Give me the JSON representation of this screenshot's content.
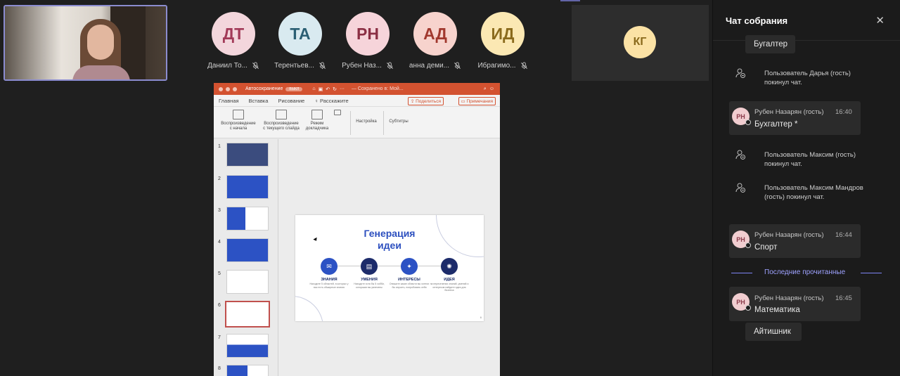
{
  "meeting": {
    "participants": [
      {
        "initials": "ДТ",
        "name": "Даниил То...",
        "bg": "#f3d6dc",
        "fg": "#a23a58"
      },
      {
        "initials": "ТА",
        "name": "Терентьев...",
        "bg": "#d9eaf0",
        "fg": "#2b5f74"
      },
      {
        "initials": "РН",
        "name": "Рубен Наз...",
        "bg": "#f6d4da",
        "fg": "#8b2f44"
      },
      {
        "initials": "АД",
        "name": "анна деми...",
        "bg": "#f7d3cd",
        "fg": "#a1382e"
      },
      {
        "initials": "ИД",
        "name": "Ибрагимо...",
        "bg": "#fbe8b3",
        "fg": "#8a6a1c"
      }
    ],
    "big_tile": {
      "initials": "КГ"
    }
  },
  "ppt": {
    "title_bar": {
      "autosave": "Автосохранение",
      "toggle": "ВЫКЛ",
      "status": "— Сохранено в: Мой..."
    },
    "tabs": [
      "Главная",
      "Вставка",
      "Рисование"
    ],
    "tell_me": "Расскажите",
    "share": "Поделиться",
    "notes": "Примечания",
    "ribbon": {
      "play_start": [
        "Воспроизведение",
        "с начала"
      ],
      "play_current": [
        "Воспроизведение",
        "с текущего слайда"
      ],
      "presenter": [
        "Режим",
        "докладчика"
      ],
      "setup": "Настройка",
      "subtitles": "Субтитры"
    },
    "thumb_numbers": [
      "1",
      "2",
      "3",
      "4",
      "5",
      "6",
      "7",
      "8"
    ],
    "slide": {
      "title_line1": "Генерация",
      "title_line2": "идеи",
      "items": [
        {
          "label": "ЗНАНИЯ",
          "desc": "Находите 5 областей, в которых у вас есть обширные знания",
          "icon": "✉"
        },
        {
          "label": "УМЕНИЯ",
          "desc": "Находите хотя бы 5 хобби, которыми вы увлечены",
          "icon": "▤"
        },
        {
          "label": "ИНТЕРЕСЫ",
          "desc": "Опишите какие области вы хотели бы изучить, попробовать себя",
          "icon": "✦"
        },
        {
          "label": "ИДЕЯ",
          "desc": "на пересечении знаний, умений и интересов найдите идеи для бизнеса",
          "icon": "✺"
        }
      ],
      "page_number": "6"
    }
  },
  "chat": {
    "title": "Чат собрания",
    "close_icon": "close-icon",
    "messages": {
      "top_reply": "Бугалтер",
      "sys1": "Пользователь Дарья (гость) покинул чат.",
      "m1": {
        "initials": "РН",
        "author": "Рубен Назарян (гость)",
        "time": "16:40",
        "text": "Бухгалтер *"
      },
      "sys2": "Пользователь Максим (гость) покинул чат.",
      "sys3": "Пользователь Максим Мандров (гость) покинул чат.",
      "m2": {
        "initials": "РН",
        "author": "Рубен Назарян (гость)",
        "time": "16:44",
        "text": "Спорт"
      },
      "divider": "Последние прочитанные",
      "m3": {
        "initials": "РН",
        "author": "Рубен Назарян (гость)",
        "time": "16:45",
        "text": "Математика"
      },
      "bottom_reply": "Айтишник"
    }
  }
}
